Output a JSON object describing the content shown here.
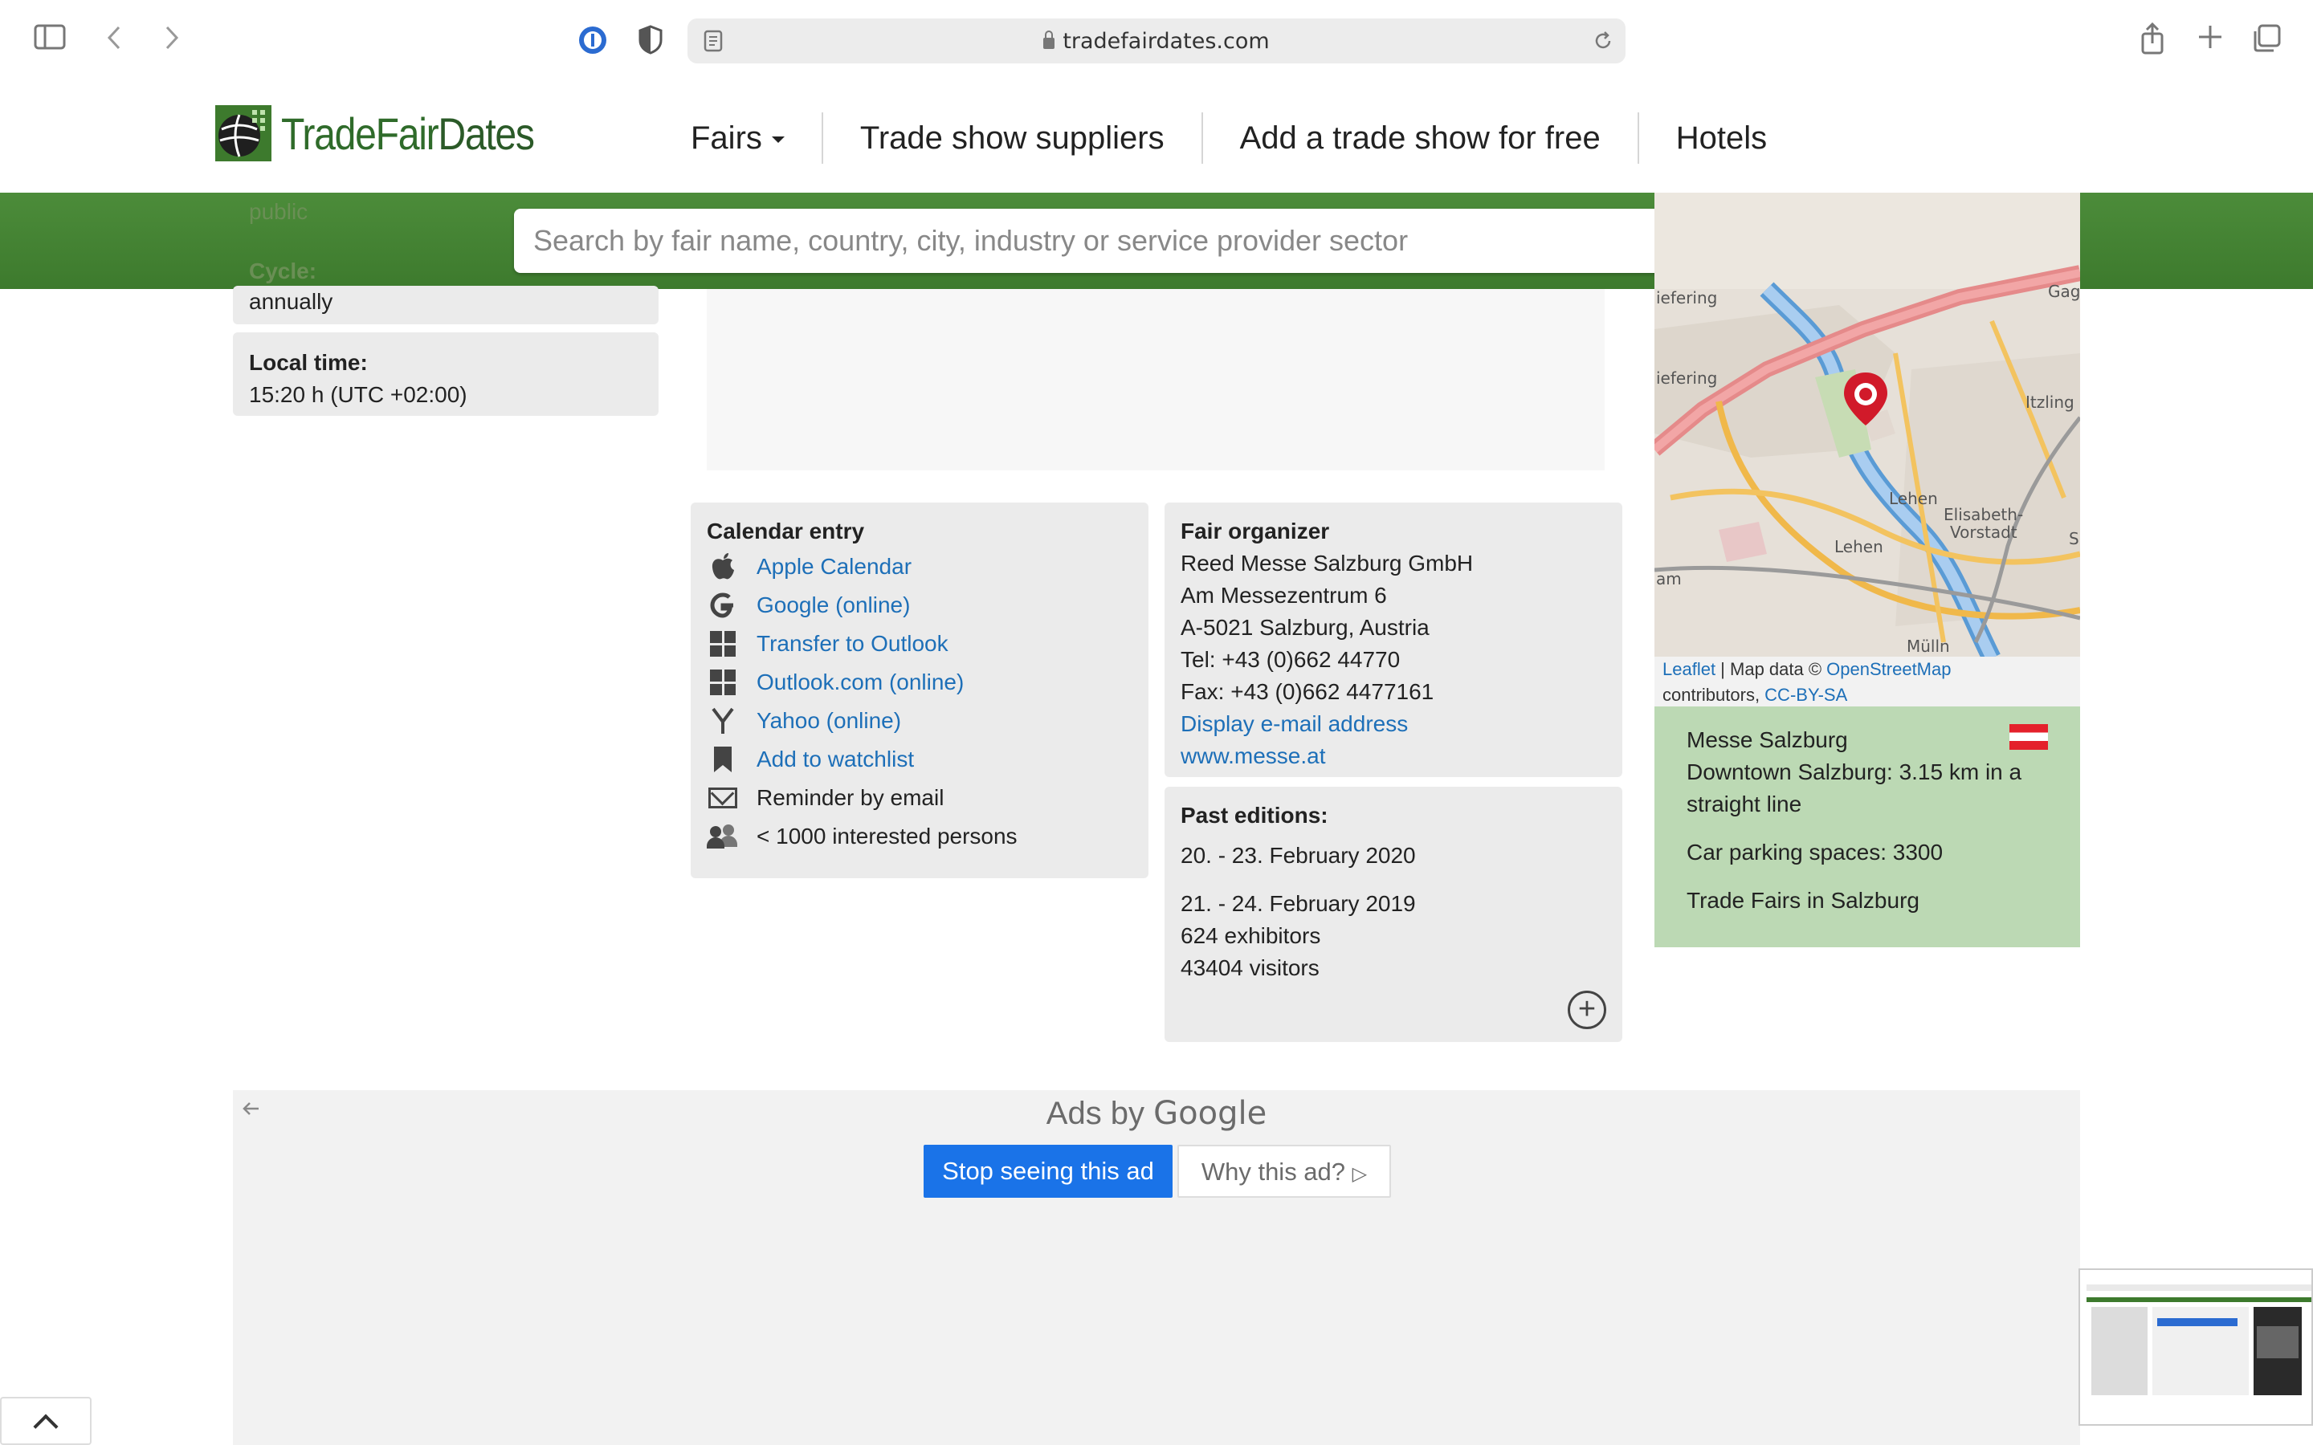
{
  "browser": {
    "url": "tradefairdates.com",
    "icons": [
      "sidebar-icon",
      "back-icon",
      "forward-icon",
      "password-icon",
      "shield-icon",
      "reader-icon",
      "reload-icon",
      "share-icon",
      "new-tab-icon",
      "tabs-icon"
    ]
  },
  "site": {
    "logo_text_a": "TradeFair",
    "logo_text_b": "Dates",
    "nav": {
      "fairs": "Fairs",
      "suppliers": "Trade show suppliers",
      "add": "Add a trade show for free",
      "hotels": "Hotels"
    },
    "search": {
      "placeholder": "Search by fair name, country, city, industry or service provider sector"
    }
  },
  "left": {
    "partial_value": "public",
    "cycle_label": "Cycle:",
    "cycle_value": "annually",
    "localtime_label": "Local time:",
    "localtime_value": "15:20 h (UTC +02:00)"
  },
  "calendar": {
    "title": "Calendar entry",
    "items": {
      "apple": "Apple Calendar",
      "google": "Google (online)",
      "outlook": "Transfer to Outlook",
      "outlookcom": "Outlook.com (online)",
      "yahoo": "Yahoo (online)",
      "watchlist": "Add to watchlist",
      "reminder": "Reminder by email",
      "interested": "< 1000 interested persons"
    }
  },
  "organizer": {
    "title": "Fair organizer",
    "name": "Reed Messe Salzburg GmbH",
    "street": "Am Messezentrum 6",
    "city": "A-5021 Salzburg, Austria",
    "tel": "Tel: +43 (0)662 44770",
    "fax": "Fax: +43 (0)662 4477161",
    "email": "Display e-mail address",
    "web": "www.messe.at"
  },
  "past": {
    "title": "Past editions:",
    "e1_dates": "20. - 23. February 2020",
    "e2_dates": "21. - 24. February 2019",
    "e2_exhibitors": "624 exhibitors",
    "e2_visitors": "43404 visitors"
  },
  "map": {
    "labels": {
      "liefering_top": "iefering",
      "liefering": "iefering",
      "gagiham": "Gagiham",
      "itzling": "Itzling",
      "lehen1": "Lehen",
      "elisabeth": "Elisabeth-",
      "vorstadt": "Vorstadt",
      "lehen2": "Lehen",
      "mulln": "Mülln",
      "ham": "am",
      "s": "S"
    },
    "attrib_leaflet": "Leaflet",
    "attrib_sep": " | Map data © ",
    "attrib_osm": "OpenStreetMap",
    "attrib_contrib": "contributors, ",
    "attrib_license": "CC-BY-SA"
  },
  "venue": {
    "name": "Messe Salzburg",
    "distance": "Downtown Salzburg: 3.15 km in a straight line",
    "parking": "Car parking spaces: 3300",
    "fairs_link": "Trade Fairs in Salzburg",
    "flag_colors": [
      "#e4212b",
      "#ffffff",
      "#e4212b"
    ]
  },
  "ad": {
    "ads_by": "Ads by ",
    "google": "Google",
    "stop": "Stop seeing this ad",
    "why": "Why this ad?"
  },
  "colors": {
    "brand_green": "#3d7a2d",
    "link_blue": "#1d6fb8",
    "search_button": "#2b7fb0",
    "venue_bg": "#bcd9b4",
    "google_blue": "#1a73e8"
  }
}
